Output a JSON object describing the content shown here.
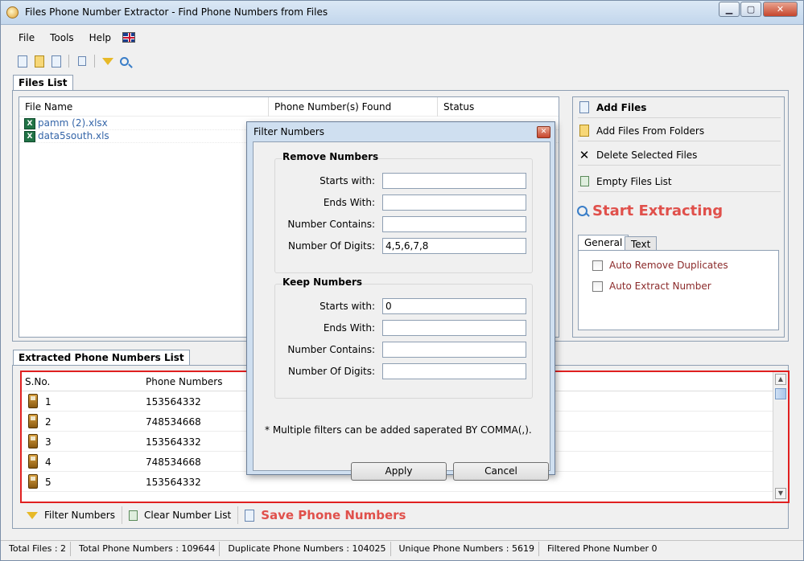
{
  "window": {
    "title": "Files Phone Number Extractor - Find Phone Numbers from Files"
  },
  "menu": [
    "File",
    "Tools",
    "Help"
  ],
  "tabs": {
    "files_list": "Files List",
    "extracted": "Extracted Phone Numbers List"
  },
  "files_list": {
    "columns": [
      "File Name",
      "Phone Number(s) Found",
      "Status"
    ],
    "rows": [
      {
        "name": "pamm (2).xlsx"
      },
      {
        "name": "data5south.xls"
      }
    ]
  },
  "actions": {
    "add_files": "Add Files",
    "add_folders": "Add Files From Folders",
    "delete_selected": "Delete Selected Files",
    "empty_list": "Empty Files List",
    "start_extracting": "Start Extracting"
  },
  "options": {
    "tab_general": "General",
    "tab_text": "Text",
    "auto_remove_duplicates": "Auto Remove Duplicates",
    "auto_extract_number": "Auto Extract Number"
  },
  "extracted": {
    "columns": [
      "S.No.",
      "Phone Numbers"
    ],
    "rows": [
      {
        "sno": "1",
        "number": "153564332"
      },
      {
        "sno": "2",
        "number": "748534668"
      },
      {
        "sno": "3",
        "number": "153564332"
      },
      {
        "sno": "4",
        "number": "748534668"
      },
      {
        "sno": "5",
        "number": "153564332"
      }
    ]
  },
  "bottom": {
    "filter": "Filter Numbers",
    "clear": "Clear Number List",
    "save": "Save Phone Numbers"
  },
  "status": {
    "total_files": "Total Files :  2",
    "total_numbers": "Total Phone Numbers :   109644",
    "duplicate": "Duplicate Phone Numbers :   104025",
    "unique": "Unique Phone Numbers :   5619",
    "filtered": "Filtered Phone Number  0"
  },
  "dialog": {
    "title": "Filter Numbers",
    "remove_group": "Remove Numbers",
    "keep_group": "Keep Numbers",
    "labels": {
      "starts_with": "Starts with:",
      "ends_with": "Ends With:",
      "contains": "Number Contains:",
      "digits": "Number Of Digits:"
    },
    "remove_values": {
      "starts": "",
      "ends": "",
      "contains": "",
      "digits": "4,5,6,7,8"
    },
    "keep_values": {
      "starts": "0",
      "ends": "",
      "contains": "",
      "digits": ""
    },
    "note": "* Multiple filters can be added saperated BY COMMA(,).",
    "apply": "Apply",
    "cancel": "Cancel"
  }
}
